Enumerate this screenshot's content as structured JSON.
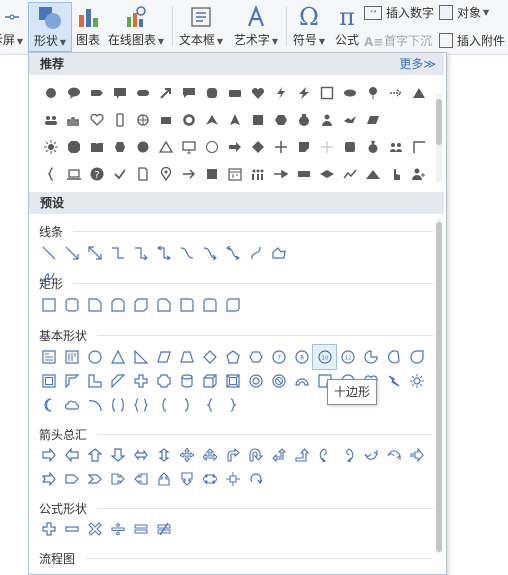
{
  "ribbon": {
    "left_partial": "拆屏",
    "shapes": "形状",
    "chart": "图表",
    "online_chart": "在线图表",
    "textbox": "文本框",
    "wordart": "艺术字",
    "symbol": "符号",
    "formula": "公式",
    "insert_number": "插入数字",
    "dropcap": "首字下沉",
    "object": "对象",
    "attachment": "插入附件"
  },
  "panel": {
    "recommended": "推荐",
    "more": "更多≫",
    "preset": "预设",
    "categories": {
      "lines": "线条",
      "rect": "矩形",
      "basic": "基本形状",
      "arrows": "箭头总汇",
      "formula": "公式形状",
      "flow": "流程图"
    },
    "tooltip": "十边形",
    "basic_number_labels": [
      "7",
      "8",
      "10",
      "12"
    ]
  },
  "colors": {
    "accent": "#4a74b8",
    "dark_icon": "#5a5a5a",
    "section_bg": "#e4e8ef"
  }
}
